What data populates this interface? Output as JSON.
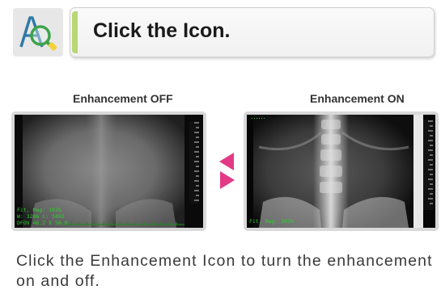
{
  "header": {
    "icon": "enhancement-icon",
    "title": "Click the Icon."
  },
  "panels": {
    "off": {
      "label": "Enhancement OFF",
      "overlay": [
        "Fit, Mag: 103%",
        "W: 3206 L: 3492",
        "DFOV 46.2 X 58.0"
      ]
    },
    "on": {
      "label": "Enhancement ON",
      "overlay": [
        "Fit, Mag: 103%"
      ]
    }
  },
  "caption": "Click the Enhancement Icon to turn the enhancement on and off.",
  "colors": {
    "arrow": "#e23a86",
    "overlay_text": "#29d42b",
    "accent": "#b9d774"
  }
}
